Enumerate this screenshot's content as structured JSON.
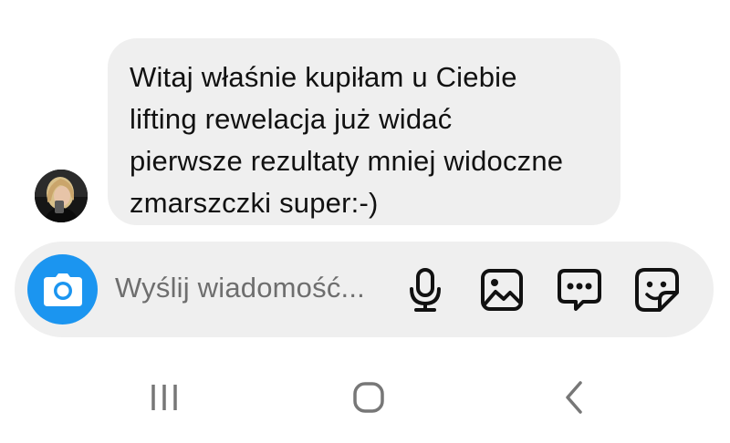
{
  "message": {
    "lines": [
      "Witaj właśnie kupiłam u Ciebie",
      "lifting rewelacja już widać",
      "pierwsze rezultaty mniej widoczne",
      "zmarszczki super:-)"
    ]
  },
  "composer": {
    "placeholder": "Wyślij wiadomość...",
    "icons": [
      "camera-icon",
      "microphone-icon",
      "gallery-icon",
      "message-options-icon",
      "sticker-icon"
    ],
    "accent": "#1b95f0"
  },
  "navigation": {
    "icons": [
      "recent-apps-icon",
      "home-icon",
      "back-icon"
    ]
  },
  "colors": {
    "bubble": "#efefef",
    "composer": "#efefef",
    "text": "#111111",
    "placeholder": "#6e6e6e"
  }
}
